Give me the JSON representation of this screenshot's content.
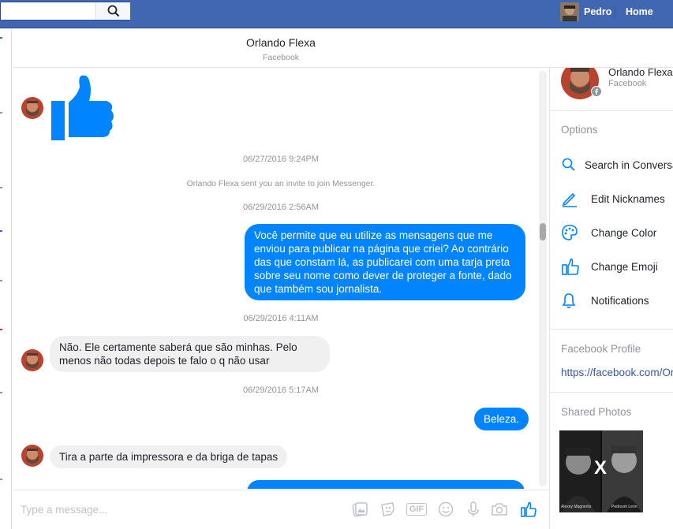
{
  "topbar": {
    "user_name": "Pedro",
    "home_label": "Home",
    "brand_color": "#4267b2"
  },
  "conversation": {
    "title": "Orlando Flexa",
    "subtitle": "Facebook"
  },
  "messages": {
    "items": [
      {
        "type": "emoji",
        "sender": "Orlando Flexa",
        "icon": "thumbs-up-icon"
      },
      {
        "type": "timestamp",
        "text": "06/27/2016 9:24PM"
      },
      {
        "type": "system",
        "text": "Orlando Flexa sent you an invite to join Messenger."
      },
      {
        "type": "timestamp",
        "text": "06/29/2016 2:56AM"
      },
      {
        "type": "outgoing",
        "text": "Você permite que eu utilize as mensagens que me enviou para publicar na página que criei? Ao contrário das que constam lá, as publicarei com uma tarja preta sobre seu nome como dever de proteger a fonte, dado que também sou jornalista."
      },
      {
        "type": "timestamp",
        "text": "06/29/2016 4:11AM"
      },
      {
        "type": "incoming",
        "text": "Não.  Ele certamente saberá que são minhas. Pelo menos não todas depois te falo o q não usar"
      },
      {
        "type": "timestamp",
        "text": "06/29/2016 5:17AM"
      },
      {
        "type": "outgoing",
        "text": "Beleza."
      },
      {
        "type": "incoming",
        "text": "Tira a parte da impressora e da briga de tapas"
      }
    ]
  },
  "composer": {
    "placeholder": "Type a message...",
    "gif_label": "GIF",
    "tools": [
      "image-icon",
      "sticker-icon",
      "gif-icon",
      "emoji-icon",
      "microphone-icon",
      "camera-icon",
      "thumbs-up-icon"
    ]
  },
  "right_panel": {
    "name": "Orlando Flexa",
    "subtitle": "Facebook",
    "options_heading": "Options",
    "options": [
      {
        "label": "Search in Conversation",
        "icon": "search-icon"
      },
      {
        "label": "Edit Nicknames",
        "icon": "pencil-icon"
      },
      {
        "label": "Change Color",
        "icon": "palette-icon"
      },
      {
        "label": "Change Emoji",
        "icon": "thumbs-up-icon"
      },
      {
        "label": "Notifications",
        "icon": "bell-icon"
      }
    ],
    "profile_heading": "Facebook Profile",
    "profile_link": "https://facebook.com/Orlando",
    "photos_heading": "Shared Photos",
    "photo_x": "X",
    "photo_caption_left": "Alexey Magnerits",
    "photo_caption_right": "Pedrosm Lenn"
  },
  "colors": {
    "outgoing_bubble": "#0084ff",
    "incoming_bubble": "#f1f0f0",
    "meta_text": "#90949c",
    "link": "#365899"
  }
}
